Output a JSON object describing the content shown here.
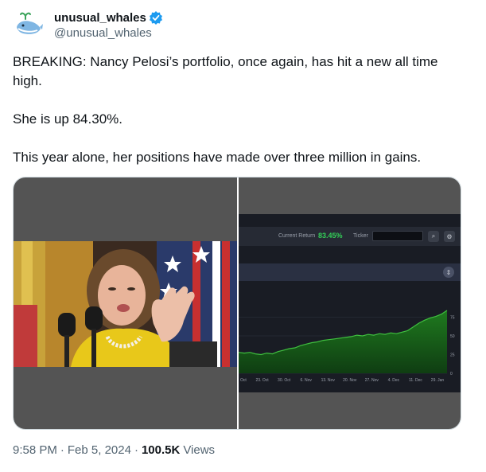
{
  "author": {
    "display_name": "unusual_whales",
    "handle": "@unusual_whales",
    "avatar_icon": "whale-icon",
    "verified_color": "#1d9bf0"
  },
  "tweet": {
    "paragraphs": [
      "BREAKING: Nancy Pelosi’s portfolio, once again, has hit a new all time high.",
      "She is up 84.30%.",
      "This year alone, her positions have made over three million in gains."
    ]
  },
  "media": {
    "photo_icon": "press-photo-image",
    "screenshot": {
      "current_return_label": "Current Return",
      "current_return_value": "83.45%",
      "ticker_label": "Ticker",
      "search_icon": "search-icon",
      "menu_icon": "gear-icon",
      "panel_icon": "expand-icon"
    }
  },
  "chart_data": {
    "type": "area",
    "series": [
      {
        "values": [
          28,
          27,
          28,
          26,
          25,
          27,
          26,
          29,
          31,
          33,
          34,
          37,
          39,
          41,
          42,
          44,
          45,
          46,
          47,
          48,
          49,
          51,
          50,
          52,
          51,
          53,
          52,
          54,
          53,
          55,
          57,
          62,
          67,
          71,
          74,
          76,
          79,
          84
        ]
      }
    ],
    "x_tick_labels": [
      "Oct",
      "23. Oct",
      "30. Oct",
      "6. Nov",
      "13. Nov",
      "20. Nov",
      "27. Nov",
      "4. Dec",
      "11. Dec",
      "29. Jan"
    ],
    "y_tick_labels": [
      "0",
      "25",
      "50",
      "75"
    ],
    "ylim": [
      0,
      100
    ],
    "colors": {
      "line": "#3fbf3f",
      "fill_top": "#1f7a1f",
      "fill_bottom": "#0f3d12",
      "background": "#191c24"
    },
    "grid": true
  },
  "footer": {
    "time": "9:58 PM",
    "separator": "·",
    "date": "Feb 5, 2024",
    "views_count": "100.5K",
    "views_label": "Views"
  }
}
